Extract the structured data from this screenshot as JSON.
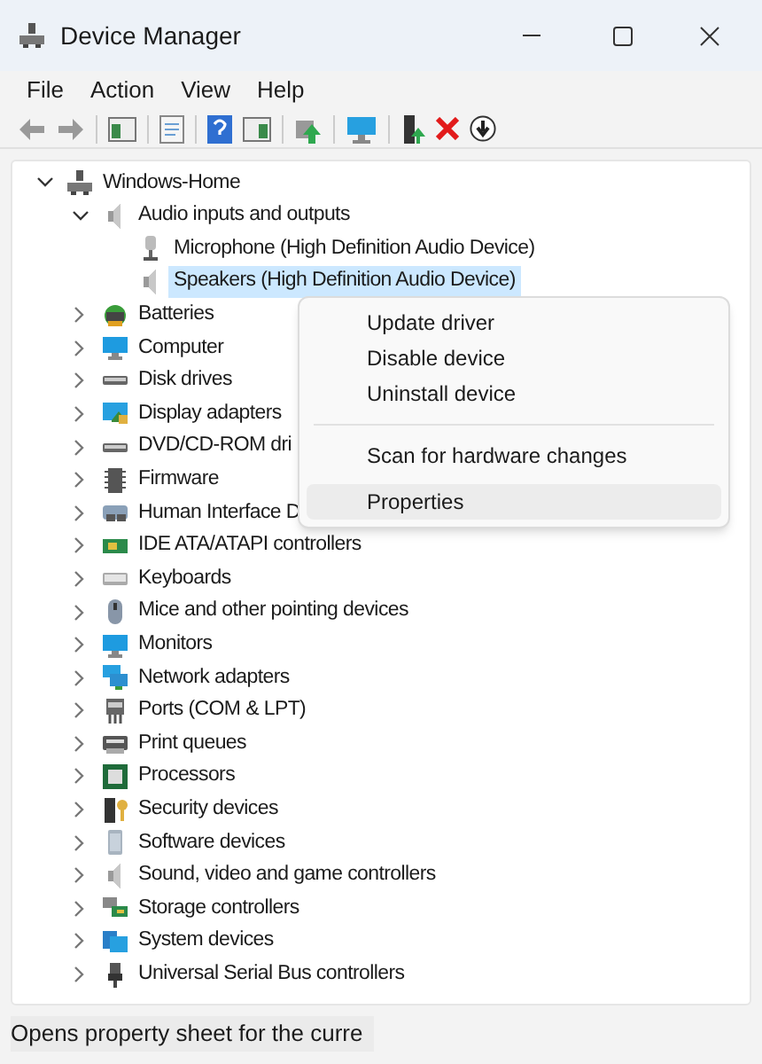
{
  "window": {
    "title": "Device Manager"
  },
  "menu_bar": [
    "File",
    "Action",
    "View",
    "Help"
  ],
  "tree": [
    {
      "label": "Windows-Home",
      "kind": "pc",
      "expanded": true,
      "selected": false,
      "children": [
        {
          "label": "Audio inputs and outputs",
          "kind": "speaker",
          "expanded": true,
          "selected": false,
          "children": [
            {
              "label": "Microphone (High Definition Audio Device)",
              "kind": "mic",
              "selected": false
            },
            {
              "label": "Speakers (High Definition Audio Device)",
              "kind": "speaker",
              "selected": true
            }
          ]
        },
        {
          "label": "Batteries",
          "kind": "battery",
          "expanded": false,
          "selected": false
        },
        {
          "label": "Computer",
          "kind": "monitor",
          "expanded": false,
          "selected": false
        },
        {
          "label": "Disk drives",
          "kind": "drive",
          "expanded": false,
          "selected": false
        },
        {
          "label": "Display adapters",
          "kind": "display",
          "expanded": false,
          "selected": false
        },
        {
          "label": "DVD/CD-ROM dri",
          "kind": "drive",
          "expanded": false,
          "selected": false
        },
        {
          "label": "Firmware",
          "kind": "chip",
          "expanded": false,
          "selected": false
        },
        {
          "label": "Human Interface D",
          "kind": "hid",
          "expanded": false,
          "selected": false
        },
        {
          "label": "IDE ATA/ATAPI controllers",
          "kind": "card",
          "expanded": false,
          "selected": false
        },
        {
          "label": "Keyboards",
          "kind": "keyboard",
          "expanded": false,
          "selected": false
        },
        {
          "label": "Mice and other pointing devices",
          "kind": "mouse",
          "expanded": false,
          "selected": false
        },
        {
          "label": "Monitors",
          "kind": "monitor",
          "expanded": false,
          "selected": false
        },
        {
          "label": "Network adapters",
          "kind": "network",
          "expanded": false,
          "selected": false
        },
        {
          "label": "Ports (COM & LPT)",
          "kind": "port",
          "expanded": false,
          "selected": false
        },
        {
          "label": "Print queues",
          "kind": "printer",
          "expanded": false,
          "selected": false
        },
        {
          "label": "Processors",
          "kind": "processor",
          "expanded": false,
          "selected": false
        },
        {
          "label": "Security devices",
          "kind": "security",
          "expanded": false,
          "selected": false
        },
        {
          "label": "Software devices",
          "kind": "software",
          "expanded": false,
          "selected": false
        },
        {
          "label": "Sound, video and game controllers",
          "kind": "speaker",
          "expanded": false,
          "selected": false
        },
        {
          "label": "Storage controllers",
          "kind": "storage",
          "expanded": false,
          "selected": false
        },
        {
          "label": "System devices",
          "kind": "system",
          "expanded": false,
          "selected": false
        },
        {
          "label": "Universal Serial Bus controllers",
          "kind": "usb",
          "expanded": false,
          "selected": false
        }
      ]
    }
  ],
  "context_menu": [
    {
      "kind": "item",
      "label": "Update driver",
      "selected": false
    },
    {
      "kind": "item",
      "label": "Disable device",
      "selected": false
    },
    {
      "kind": "item",
      "label": "Uninstall device",
      "selected": false
    },
    {
      "kind": "separator"
    },
    {
      "kind": "item",
      "label": "Scan for hardware changes",
      "selected": false
    },
    {
      "kind": "item",
      "label": "Properties",
      "selected": true
    }
  ],
  "status_bar": "Opens property sheet for the curre"
}
